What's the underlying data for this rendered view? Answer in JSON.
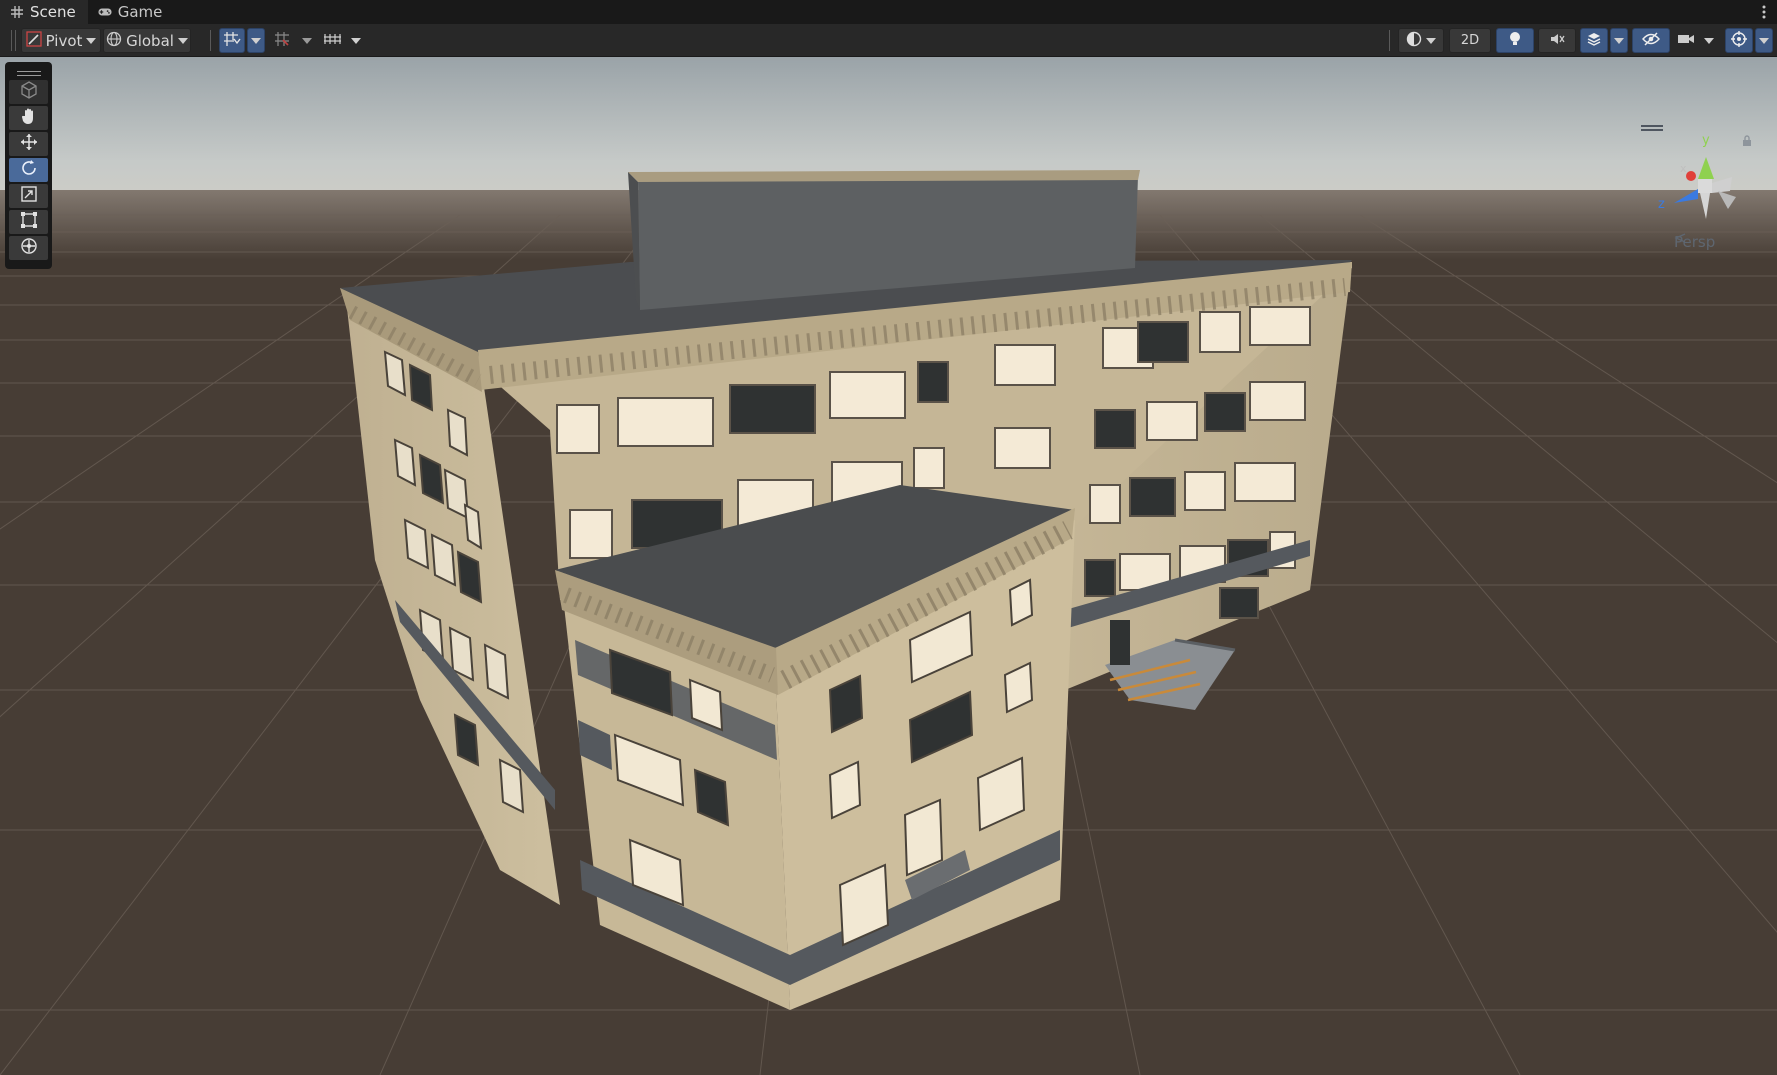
{
  "tabs": [
    {
      "label": "Scene",
      "icon": "grid-hash-icon",
      "active": true
    },
    {
      "label": "Game",
      "icon": "gamepad-icon",
      "active": false
    }
  ],
  "toolbar": {
    "pivot_label": "Pivot",
    "global_label": "Global",
    "mode_2d_label": "2D"
  },
  "tools": [
    {
      "name": "view-tool",
      "icon": "hand-icon",
      "selected": false
    },
    {
      "name": "move-tool",
      "icon": "move-arrows-icon",
      "selected": false
    },
    {
      "name": "rotate-tool",
      "icon": "rotate-icon",
      "selected": true
    },
    {
      "name": "scale-tool",
      "icon": "scale-icon",
      "selected": false
    },
    {
      "name": "rect-tool",
      "icon": "rect-transform-icon",
      "selected": false
    },
    {
      "name": "transform-tool",
      "icon": "transform-icon",
      "selected": false
    }
  ],
  "gizmo": {
    "projection_label": "Persp",
    "axes": [
      {
        "label": "y",
        "color": "#8fd14f"
      },
      {
        "label": "x",
        "color": "#e0403a"
      },
      {
        "label": "z",
        "color": "#3a7ae0"
      }
    ]
  },
  "colors": {
    "accent_selected": "#3e5a86",
    "ground": "#473d35",
    "sky_top": "#9ca4a8",
    "facade": "#c2b394",
    "roof": "#4b4d50"
  }
}
